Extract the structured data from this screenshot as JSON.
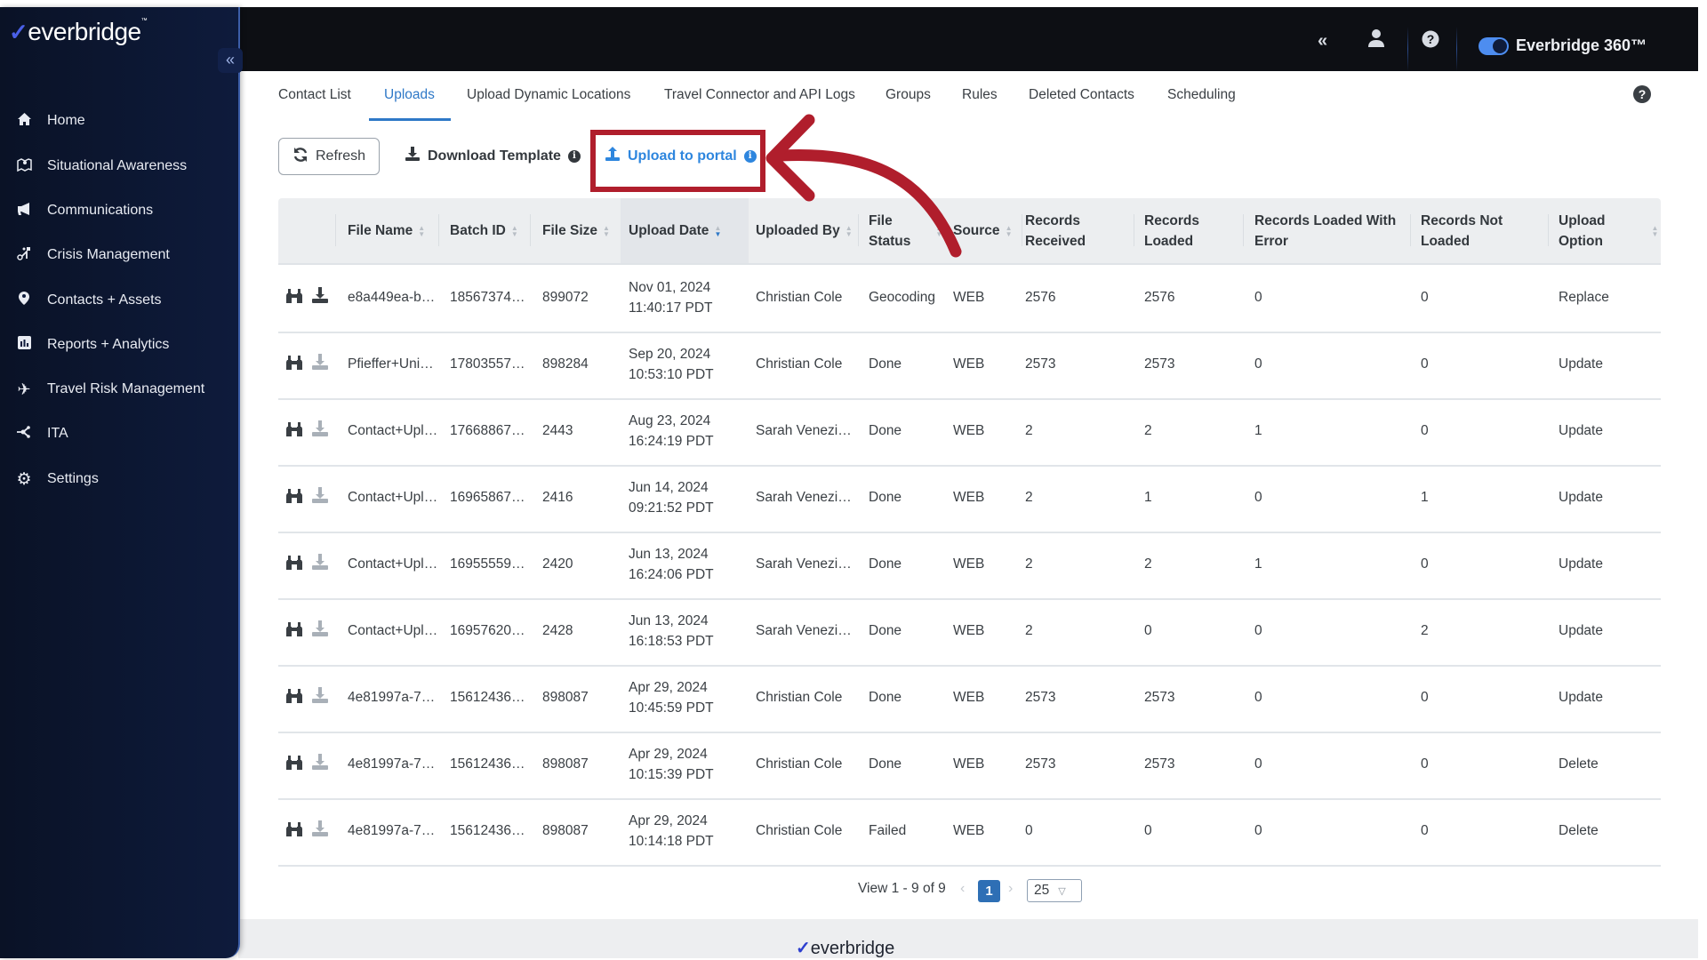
{
  "header": {
    "product_name": "Everbridge 360™",
    "toggle_on": true,
    "icons": [
      "collapse-double-chevron-icon",
      "user-icon",
      "help-icon"
    ]
  },
  "sidebar": {
    "logo_text": "everbridge",
    "collapse_label": "«",
    "items": [
      {
        "label": "Home",
        "icon": "home-icon",
        "glyph": "⌂"
      },
      {
        "label": "Situational Awareness",
        "icon": "map-pin-icon",
        "glyph": "⛶"
      },
      {
        "label": "Communications",
        "icon": "megaphone-icon",
        "glyph": "📢"
      },
      {
        "label": "Crisis Management",
        "icon": "route-icon",
        "glyph": "⚐"
      },
      {
        "label": "Contacts + Assets",
        "icon": "location-pin-icon",
        "glyph": "⬮"
      },
      {
        "label": "Reports + Analytics",
        "icon": "bar-chart-icon",
        "glyph": "▦"
      },
      {
        "label": "Travel Risk Management",
        "icon": "plane-icon",
        "glyph": "✈"
      },
      {
        "label": "ITA",
        "icon": "network-icon",
        "glyph": "⤫"
      },
      {
        "label": "Settings",
        "icon": "gear-icon",
        "glyph": "⚙"
      }
    ]
  },
  "tabs": [
    {
      "label": "Contact List",
      "active": false
    },
    {
      "label": "Uploads",
      "active": true
    },
    {
      "label": "Upload Dynamic Locations",
      "active": false
    },
    {
      "label": "Travel Connector and API Logs",
      "active": false
    },
    {
      "label": "Groups",
      "active": false
    },
    {
      "label": "Rules",
      "active": false
    },
    {
      "label": "Deleted Contacts",
      "active": false
    },
    {
      "label": "Scheduling",
      "active": false
    }
  ],
  "toolbar": {
    "refresh_label": "Refresh",
    "download_template_label": "Download Template",
    "upload_portal_label": "Upload to portal"
  },
  "annotation": {
    "highlight_color": "#b01e2c",
    "target": "Upload to portal"
  },
  "table": {
    "sorted_column": "Upload Date",
    "sort_direction": "desc",
    "columns": [
      "",
      "File Name",
      "Batch ID",
      "File Size",
      "Upload Date",
      "Uploaded By",
      "File Status",
      "Source",
      "Records Received",
      "Records Loaded",
      "Records Loaded With Error",
      "Records Not Loaded",
      "Upload Option"
    ],
    "header_lines": {
      "file_status": [
        "File",
        "Status"
      ],
      "records_received": [
        "Records",
        "Received"
      ],
      "records_loaded": [
        "Records",
        "Loaded"
      ],
      "records_loaded_with_error": [
        "Records Loaded With",
        "Error"
      ],
      "records_not_loaded": [
        "Records Not",
        "Loaded"
      ],
      "upload_option": [
        "Upload",
        "Option"
      ]
    },
    "rows": [
      {
        "file_name": "e8a449ea-b…",
        "batch_id": "18567374…",
        "file_size": "899072",
        "date": "Nov 01, 2024",
        "time": "11:40:17 PDT",
        "uploaded_by": "Christian Cole",
        "status": "Geocoding",
        "source": "WEB",
        "received": "2576",
        "loaded": "2576",
        "loaded_err": "0",
        "not_loaded": "0",
        "option": "Replace",
        "download_enabled": true
      },
      {
        "file_name": "Pfieffer+Uni…",
        "batch_id": "17803557…",
        "file_size": "898284",
        "date": "Sep 20, 2024",
        "time": "10:53:10 PDT",
        "uploaded_by": "Christian Cole",
        "status": "Done",
        "source": "WEB",
        "received": "2573",
        "loaded": "2573",
        "loaded_err": "0",
        "not_loaded": "0",
        "option": "Update",
        "download_enabled": false
      },
      {
        "file_name": "Contact+Upl…",
        "batch_id": "17668867…",
        "file_size": "2443",
        "date": "Aug 23, 2024",
        "time": "16:24:19 PDT",
        "uploaded_by": "Sarah Venezi…",
        "status": "Done",
        "source": "WEB",
        "received": "2",
        "loaded": "2",
        "loaded_err": "1",
        "not_loaded": "0",
        "option": "Update",
        "download_enabled": false
      },
      {
        "file_name": "Contact+Upl…",
        "batch_id": "16965867…",
        "file_size": "2416",
        "date": "Jun 14, 2024",
        "time": "09:21:52 PDT",
        "uploaded_by": "Sarah Venezi…",
        "status": "Done",
        "source": "WEB",
        "received": "2",
        "loaded": "1",
        "loaded_err": "0",
        "not_loaded": "1",
        "option": "Update",
        "download_enabled": false
      },
      {
        "file_name": "Contact+Upl…",
        "batch_id": "16955559…",
        "file_size": "2420",
        "date": "Jun 13, 2024",
        "time": "16:24:06 PDT",
        "uploaded_by": "Sarah Venezi…",
        "status": "Done",
        "source": "WEB",
        "received": "2",
        "loaded": "2",
        "loaded_err": "1",
        "not_loaded": "0",
        "option": "Update",
        "download_enabled": false
      },
      {
        "file_name": "Contact+Upl…",
        "batch_id": "16957620…",
        "file_size": "2428",
        "date": "Jun 13, 2024",
        "time": "16:18:53 PDT",
        "uploaded_by": "Sarah Venezi…",
        "status": "Done",
        "source": "WEB",
        "received": "2",
        "loaded": "0",
        "loaded_err": "0",
        "not_loaded": "2",
        "option": "Update",
        "download_enabled": false
      },
      {
        "file_name": "4e81997a-7…",
        "batch_id": "15612436…",
        "file_size": "898087",
        "date": "Apr 29, 2024",
        "time": "10:45:59 PDT",
        "uploaded_by": "Christian Cole",
        "status": "Done",
        "source": "WEB",
        "received": "2573",
        "loaded": "2573",
        "loaded_err": "0",
        "not_loaded": "0",
        "option": "Update",
        "download_enabled": false
      },
      {
        "file_name": "4e81997a-7…",
        "batch_id": "15612436…",
        "file_size": "898087",
        "date": "Apr 29, 2024",
        "time": "10:15:39 PDT",
        "uploaded_by": "Christian Cole",
        "status": "Done",
        "source": "WEB",
        "received": "2573",
        "loaded": "2573",
        "loaded_err": "0",
        "not_loaded": "0",
        "option": "Delete",
        "download_enabled": false
      },
      {
        "file_name": "4e81997a-7…",
        "batch_id": "15612436…",
        "file_size": "898087",
        "date": "Apr 29, 2024",
        "time": "10:14:18 PDT",
        "uploaded_by": "Christian Cole",
        "status": "Failed",
        "source": "WEB",
        "received": "0",
        "loaded": "0",
        "loaded_err": "0",
        "not_loaded": "0",
        "option": "Delete",
        "download_enabled": false
      }
    ]
  },
  "pagination": {
    "summary": "View 1 - 9 of 9",
    "prev": "‹",
    "current_page": "1",
    "next": "›",
    "page_size": "25"
  },
  "footer": {
    "logo_text": "everbridge"
  },
  "colors": {
    "accent": "#2e78c7",
    "link": "#2e86de",
    "sidebar_bg": "#0e1b3c",
    "header_bg": "#0d0f14",
    "annotation_red": "#b01e2c"
  }
}
